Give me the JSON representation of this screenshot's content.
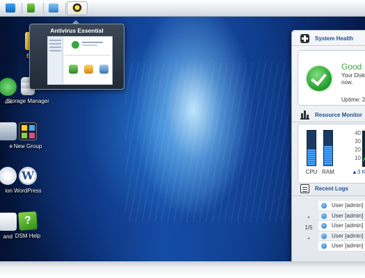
{
  "taskbar": {
    "buttons": [
      {
        "icon": "monitor-icon"
      },
      {
        "icon": "package-icon"
      },
      {
        "icon": "image-search-icon"
      },
      {
        "icon": "antivirus-shield-icon",
        "active": true
      }
    ]
  },
  "antivirus_preview": {
    "title": "Antivirus Essential"
  },
  "desktop_icons": [
    {
      "label": "EZ-Int",
      "icon": "ez-internet-icon"
    },
    {
      "label": "ate",
      "icon": "update-icon"
    },
    {
      "label": "Storage Manager",
      "icon": "storage-manager-icon"
    },
    {
      "label": "e",
      "icon": "control-panel-icon"
    },
    {
      "label": "New Group",
      "icon": "app-group-icon"
    },
    {
      "label": "ion",
      "icon": "information-icon"
    },
    {
      "label": "WordPress",
      "icon": "wordpress-icon"
    },
    {
      "label": "and",
      "icon": "command-icon"
    },
    {
      "label": "DSM Help",
      "icon": "help-icon"
    }
  ],
  "widgets": {
    "system_health": {
      "title": "System Health",
      "status": "Good",
      "message_line1": "Your Disk",
      "message_line2": "now.",
      "uptime": "Uptime: 2"
    },
    "resource_monitor": {
      "title": "Resource Monitor",
      "cpu_label": "CPU",
      "ram_label": "RAM",
      "cpu_level": 0.45,
      "ram_level": 0.55,
      "axis_ticks": [
        "40",
        "30",
        "20",
        "10"
      ],
      "network_speed": "3 K"
    },
    "recent_logs": {
      "title": "Recent Logs",
      "page": "1/5",
      "entries": [
        "User [admin]",
        "User [admin]",
        "User [admin]",
        "User [admin]",
        "User [admin]"
      ]
    }
  },
  "colors": {
    "accent": "#1d4f91",
    "good": "#3aa63a"
  }
}
